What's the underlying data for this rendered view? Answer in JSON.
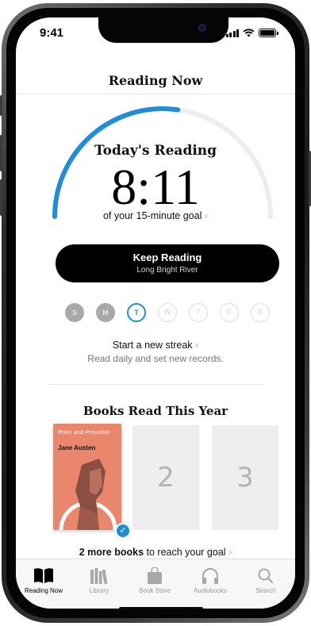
{
  "status_bar": {
    "time": "9:41"
  },
  "header": {
    "title": "Reading Now"
  },
  "today": {
    "label": "Today's Reading",
    "time": "8:11",
    "goal_text": "of your 15-minute goal",
    "goal_chevron": "›",
    "progress": 0.545,
    "ring_color": "#1f8ed6"
  },
  "keep_reading": {
    "label": "Keep Reading",
    "book": "Long Bright River"
  },
  "week": {
    "days": [
      {
        "letter": "S",
        "state": "missed"
      },
      {
        "letter": "M",
        "state": "missed"
      },
      {
        "letter": "T",
        "state": "today"
      },
      {
        "letter": "W",
        "state": "future"
      },
      {
        "letter": "T",
        "state": "future"
      },
      {
        "letter": "F",
        "state": "future"
      },
      {
        "letter": "S",
        "state": "future"
      }
    ]
  },
  "streak": {
    "title": "Start a new streak",
    "chevron": "›",
    "subtitle": "Read daily and set new records."
  },
  "books_year": {
    "title": "Books Read This Year",
    "book": {
      "title": "Pride and Prejudice",
      "author": "Jane Austen",
      "completed": true
    },
    "slots": [
      "2",
      "3"
    ],
    "goal_prefix": "2 more books",
    "goal_suffix": " to reach your goal",
    "goal_chevron": "›"
  },
  "tab_bar": {
    "tabs": [
      {
        "label": "Reading Now",
        "icon": "book-open-icon",
        "active": true
      },
      {
        "label": "Library",
        "icon": "library-icon",
        "active": false
      },
      {
        "label": "Book Store",
        "icon": "shopping-bag-icon",
        "active": false
      },
      {
        "label": "Audiobooks",
        "icon": "headphones-icon",
        "active": false
      },
      {
        "label": "Search",
        "icon": "search-icon",
        "active": false
      }
    ]
  }
}
